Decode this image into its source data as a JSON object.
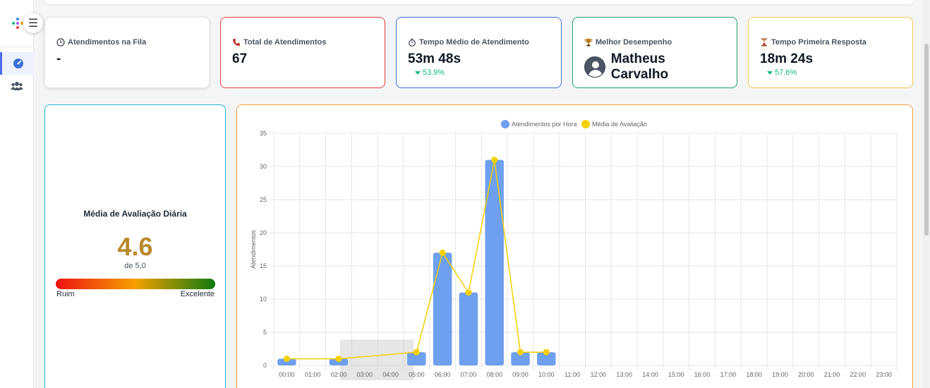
{
  "sidebar": {
    "menu_icon": "hamburger-icon",
    "items": [
      {
        "icon": "dashboard-gauge-icon",
        "active": true
      },
      {
        "icon": "users-group-icon",
        "active": false
      }
    ]
  },
  "cards": {
    "queue": {
      "title": "Atendimentos na Fila",
      "value": "-",
      "border": "#e5e7eb",
      "icon": "clock-icon"
    },
    "total": {
      "title": "Total de Atendimentos",
      "value": "67",
      "border": "#e53e3e",
      "icon": "phone-icon"
    },
    "avg_time": {
      "title": "Tempo Médio de Atendimento",
      "value": "53m 48s",
      "delta": "53.9%",
      "border": "#3b6fd8",
      "icon": "stopwatch-icon"
    },
    "best": {
      "title": "Melhor Desempenho",
      "name": "Matheus Carvalho",
      "border": "#22a06b",
      "icon": "trophy-icon"
    },
    "first_resp": {
      "title": "Tempo Primeira Resposta",
      "value": "18m 24s",
      "delta": "57.6%",
      "border": "#f2c94c",
      "icon": "hourglass-icon"
    }
  },
  "rating": {
    "title": "Média de Avaliação Diária",
    "value": "4.6",
    "sub": "de 5,0",
    "low_label": "Ruim",
    "high_label": "Excelente",
    "value_color": "#b8892b"
  },
  "chart_data": {
    "type": "bar",
    "categories": [
      "00:00",
      "01:00",
      "02:00",
      "03:00",
      "04:00",
      "05:00",
      "06:00",
      "07:00",
      "08:00",
      "09:00",
      "10:00",
      "11:00",
      "12:00",
      "13:00",
      "14:00",
      "15:00",
      "16:00",
      "17:00",
      "18:00",
      "19:00",
      "20:00",
      "21:00",
      "22:00",
      "23:00"
    ],
    "series": [
      {
        "name": "Atendimentos por Hora",
        "type": "bar",
        "color": "#6f9fef",
        "values": [
          1,
          0,
          1,
          0,
          0,
          2,
          17,
          11,
          31,
          2,
          2,
          0,
          0,
          0,
          0,
          0,
          0,
          0,
          0,
          0,
          0,
          0,
          0,
          0
        ]
      },
      {
        "name": "Média de Avaliação",
        "type": "line",
        "color": "#f5d000",
        "values": [
          1,
          null,
          1,
          null,
          null,
          2,
          17,
          11,
          31,
          2,
          2,
          null,
          null,
          null,
          null,
          null,
          null,
          null,
          null,
          null,
          null,
          null,
          null,
          null
        ]
      }
    ],
    "ylabel": "Atendimentos",
    "yticks": [
      "0",
      "5",
      "10",
      "15",
      "20",
      "25",
      "30",
      "35"
    ],
    "ylim": [
      0,
      35
    ],
    "grid": true,
    "legend_position": "top-center"
  }
}
